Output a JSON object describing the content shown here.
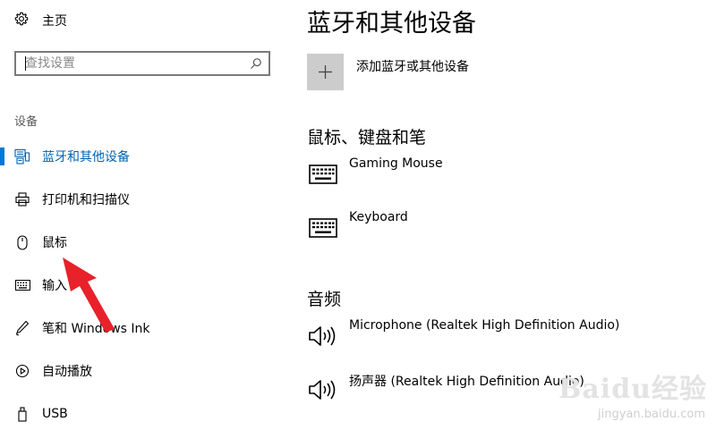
{
  "sidebar": {
    "home_label": "主页",
    "search": {
      "placeholder": "查找设置"
    },
    "section_label": "设备",
    "items": [
      {
        "label": "蓝牙和其他设备",
        "icon": "bluetooth-devices-icon",
        "active": true
      },
      {
        "label": "打印机和扫描仪",
        "icon": "printer-icon"
      },
      {
        "label": "鼠标",
        "icon": "mouse-icon"
      },
      {
        "label": "输入",
        "icon": "keyboard-icon"
      },
      {
        "label": "笔和 Windows Ink",
        "icon": "pen-icon"
      },
      {
        "label": "自动播放",
        "icon": "autoplay-icon"
      },
      {
        "label": "USB",
        "icon": "usb-icon"
      }
    ]
  },
  "main": {
    "title": "蓝牙和其他设备",
    "add_device_label": "添加蓝牙或其他设备",
    "sections": [
      {
        "title": "鼠标、键盘和笔",
        "devices": [
          {
            "name": "Gaming Mouse",
            "icon": "keyboard-icon"
          },
          {
            "name": "Keyboard",
            "icon": "keyboard-icon"
          }
        ]
      },
      {
        "title": "音频",
        "devices": [
          {
            "name": "Microphone (Realtek High Definition Audio)",
            "icon": "speaker-icon"
          },
          {
            "name": "扬声器 (Realtek High Definition Audio)",
            "icon": "speaker-icon"
          }
        ]
      }
    ]
  },
  "watermark": {
    "brand": "Baidu经验",
    "url": "jingyan.baidu.com"
  },
  "colors": {
    "accent": "#0078d7",
    "active_text": "#0063b1",
    "add_tile": "#cccccc",
    "annotation_arrow": "#e8212a"
  }
}
